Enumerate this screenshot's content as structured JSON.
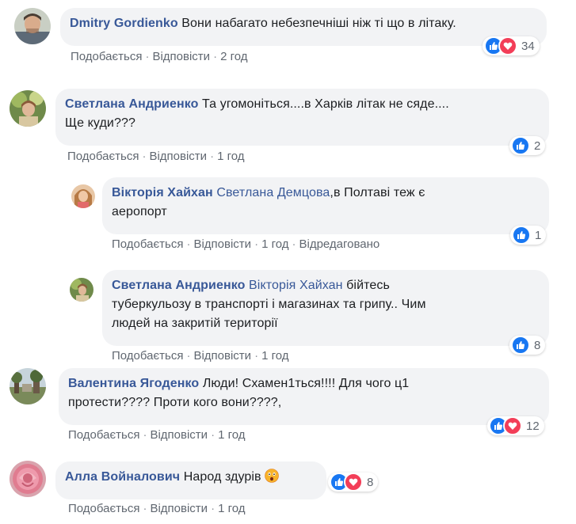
{
  "comments": [
    {
      "author": "Dmitry Gordienko",
      "text": "Вони набагато небезпечніші ніж ті що в літаку.",
      "like_label": "Подобається",
      "reply_label": "Відповісти",
      "time": "2 год",
      "reaction_count": "34",
      "reactions": [
        "like-icon",
        "love-icon"
      ]
    },
    {
      "author": "Светлана Андриенко",
      "text_line1": "Та угомоніться....в Харків літак не сяде....",
      "text_line2": "Ще куди???",
      "like_label": "Подобається",
      "reply_label": "Відповісти",
      "time": "1 год",
      "reaction_count": "2",
      "reactions": [
        "like-icon"
      ]
    },
    {
      "author": "Вікторія Хайхан",
      "mention": "Светлана Демцова",
      "text_line1": ",в Полтаві теж є",
      "text_line2": "аеропорт",
      "like_label": "Подобається",
      "reply_label": "Відповісти",
      "time": "1 год",
      "edited": "Відредаговано",
      "reaction_count": "1",
      "reactions": [
        "like-icon"
      ]
    },
    {
      "author": "Светлана Андриенко",
      "mention": "Вікторія Хайхан",
      "text_line1": "бійтесь",
      "text_line2": "туберкульозу в транспорті і магазинах та грипу.. Чим",
      "text_line3": "людей на закритій території",
      "like_label": "Подобається",
      "reply_label": "Відповісти",
      "time": "1 год",
      "reaction_count": "8",
      "reactions": [
        "like-icon"
      ]
    },
    {
      "author": "Валентина Ягоденко",
      "text_line1": "Люди! Схамен1ться!!!! Для чого ц1",
      "text_line2": "протести???? Проти кого вони????,",
      "like_label": "Подобається",
      "reply_label": "Відповісти",
      "time": "1 год",
      "reaction_count": "12",
      "reactions": [
        "like-icon",
        "love-icon"
      ]
    },
    {
      "author": "Алла Войналович",
      "text": "Народ здурів",
      "emoji": "astonished-face-emoji",
      "like_label": "Подобається",
      "reply_label": "Відповісти",
      "time": "1 год",
      "reaction_count": "8",
      "reactions": [
        "like-icon",
        "love-icon"
      ]
    }
  ],
  "separator": "·",
  "colors": {
    "author": "#385898",
    "bubble": "#f2f3f5",
    "meta": "#606770",
    "like": "#1877f2",
    "love": "#f33e58"
  }
}
